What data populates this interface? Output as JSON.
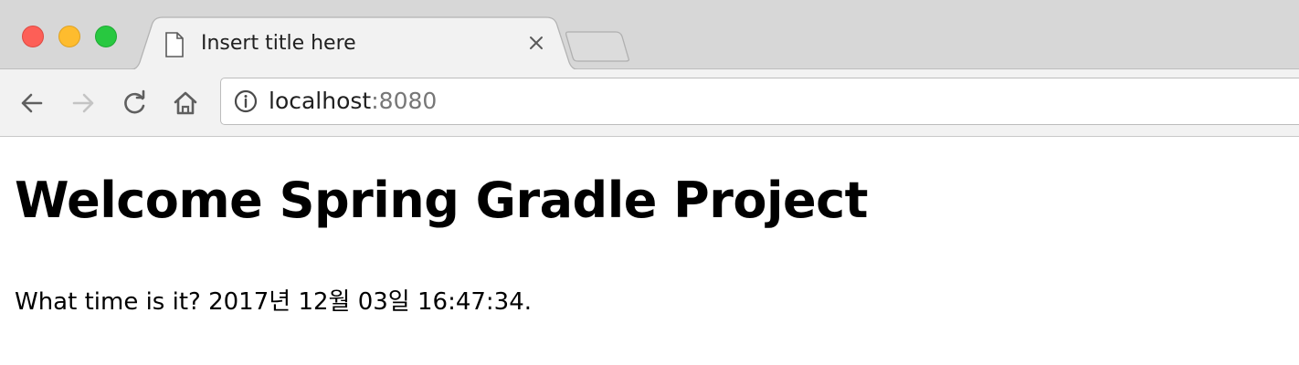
{
  "browser": {
    "tab": {
      "title": "Insert title here",
      "icon": "document-icon"
    },
    "address_bar": {
      "host": "localhost",
      "port": ":8080"
    },
    "icons": {
      "back": "back-arrow-icon",
      "forward": "forward-arrow-icon",
      "reload": "reload-icon",
      "home": "home-icon",
      "info": "info-icon",
      "close": "close-icon",
      "new_tab": "new-tab-icon"
    },
    "colors": {
      "close_light": "#fd5f57",
      "minimize_light": "#febc2e",
      "maximize_light": "#28c840"
    }
  },
  "page": {
    "heading": "Welcome Spring Gradle Project",
    "time_line": "What time is it? 2017년 12월 03일 16:47:34."
  }
}
